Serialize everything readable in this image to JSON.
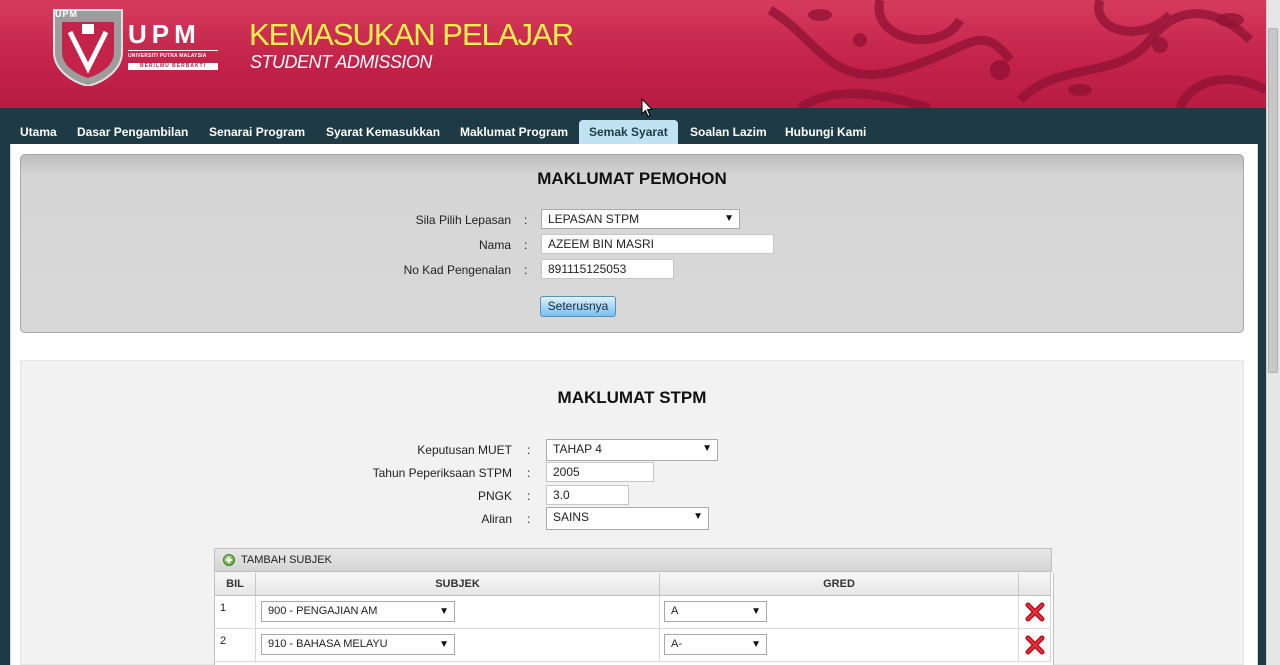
{
  "header": {
    "logo_small": "UPM",
    "logo_text": "UPM",
    "logo_university": "UNIVERSITI PUTRA MALAYSIA",
    "logo_motto": "BERILMU BERBAKTI",
    "title": "KEMASUKAN PELAJAR",
    "subtitle": "STUDENT ADMISSION",
    "brand_color": "#c4234a",
    "title_color": "#fff24a"
  },
  "nav": {
    "items": [
      {
        "label": "Utama"
      },
      {
        "label": "Dasar Pengambilan"
      },
      {
        "label": "Senarai Program"
      },
      {
        "label": "Syarat Kemasukkan"
      },
      {
        "label": "Maklumat Program"
      },
      {
        "label": "Semak Syarat"
      },
      {
        "label": "Soalan Lazim"
      },
      {
        "label": "Hubungi Kami"
      }
    ],
    "active": "Semak Syarat"
  },
  "applicant": {
    "title": "MAKLUMAT PEMOHON",
    "lepasan_label": "Sila Pilih Lepasan",
    "lepasan_value": "LEPASAN STPM",
    "nama_label": "Nama",
    "nama_value": "AZEEM BIN MASRI",
    "ic_label": "No Kad Pengenalan",
    "ic_value": "891115125053",
    "colon": ":",
    "next_button": "Seterusnya"
  },
  "stpm": {
    "title": "MAKLUMAT STPM",
    "muet_label": "Keputusan MUET",
    "muet_value": "TAHAP 4",
    "year_label": "Tahun Peperiksaan STPM",
    "year_value": "2005",
    "pngk_label": "PNGK",
    "pngk_value": "3.0",
    "aliran_label": "Aliran",
    "aliran_value": "SAINS",
    "colon": ":"
  },
  "subjects": {
    "add_label": "TAMBAH SUBJEK",
    "columns": {
      "bil": "BIL",
      "subjek": "SUBJEK",
      "gred": "GRED"
    },
    "rows": [
      {
        "bil": "1",
        "subjek": "900 - PENGAJIAN AM",
        "gred": "A"
      },
      {
        "bil": "2",
        "subjek": "910 - BAHASA MELAYU",
        "gred": "A-"
      }
    ],
    "icons": {
      "add": "add-icon",
      "delete": "delete-icon",
      "dropdown": "chevron-down-icon"
    }
  }
}
